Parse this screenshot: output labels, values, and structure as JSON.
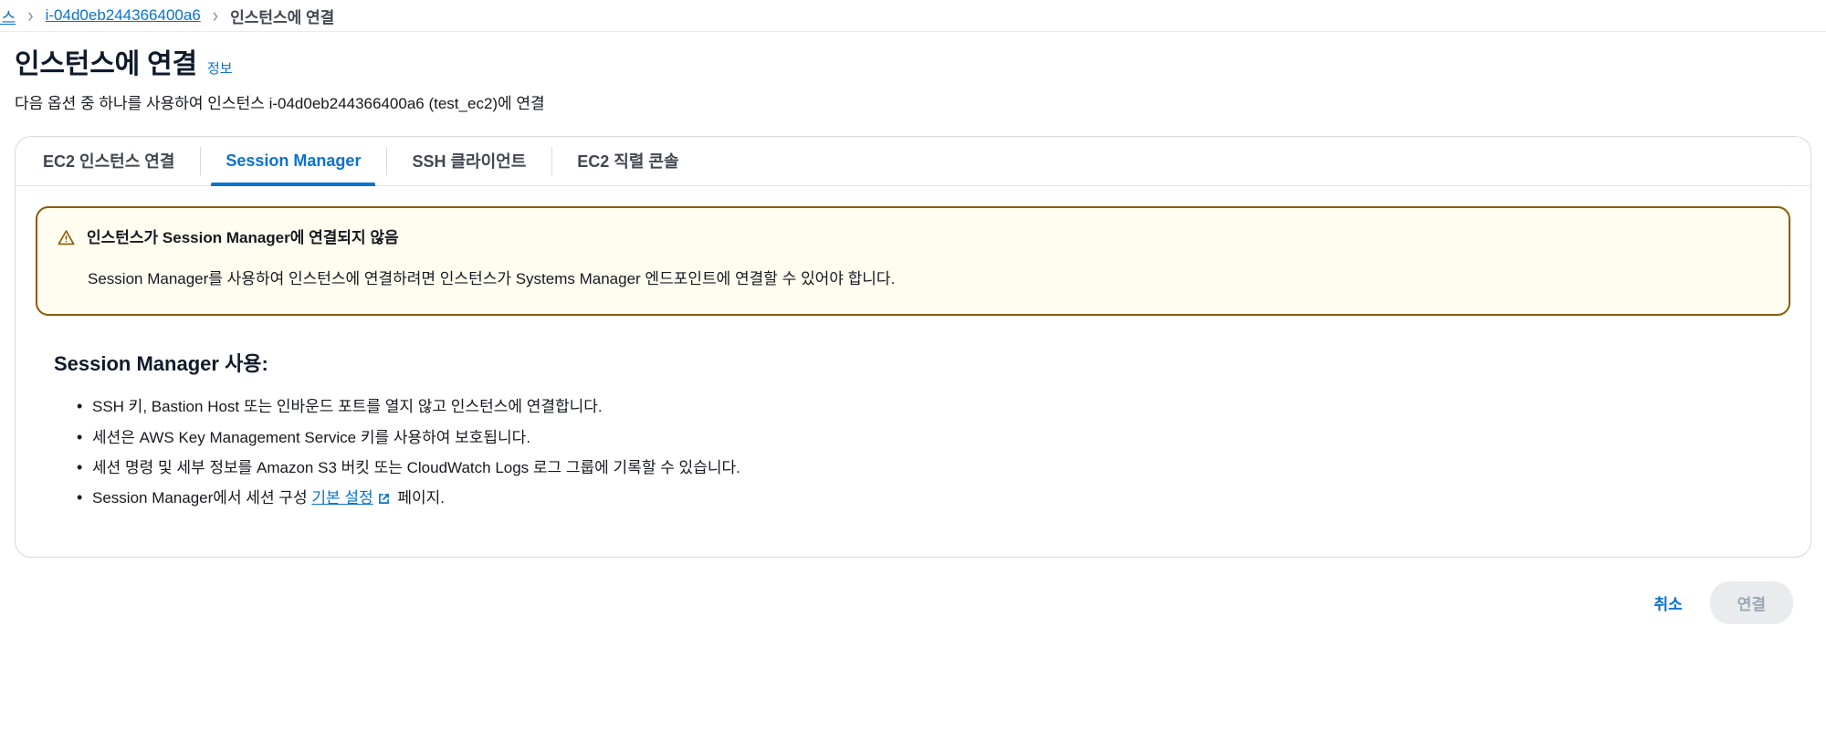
{
  "breadcrumb": {
    "items": [
      {
        "label": "턴스",
        "type": "link",
        "truncated": true
      },
      {
        "label": "i-04d0eb244366400a6",
        "type": "link"
      },
      {
        "label": "인스턴스에 연결",
        "type": "current"
      }
    ],
    "separator": "›"
  },
  "header": {
    "title": "인스턴스에 연결",
    "info_label": "정보",
    "description": "다음 옵션 중 하나를 사용하여 인스턴스 i-04d0eb244366400a6 (test_ec2)에 연결"
  },
  "tabs": [
    {
      "label": "EC2 인스턴스 연결",
      "active": false
    },
    {
      "label": "Session Manager",
      "active": true
    },
    {
      "label": "SSH 클라이언트",
      "active": false
    },
    {
      "label": "EC2 직렬 콘솔",
      "active": false
    }
  ],
  "alert": {
    "icon": "warning-triangle-icon",
    "title": "인스턴스가 Session Manager에 연결되지 않음",
    "body": "Session Manager를 사용하여 인스턴스에 연결하려면 인스턴스가 Systems Manager 엔드포인트에 연결할 수 있어야 합니다.",
    "border_color": "#8a5a0a",
    "background_color": "#fffdf0"
  },
  "usage": {
    "heading": "Session Manager 사용:",
    "items": [
      {
        "text": "SSH 키, Bastion Host 또는 인바운드 포트를 열지 않고 인스턴스에 연결합니다."
      },
      {
        "text": "세션은 AWS Key Management Service 키를 사용하여 보호됩니다."
      },
      {
        "text": "세션 명령 및 세부 정보를 Amazon S3 버킷 또는 CloudWatch Logs 로그 그룹에 기록할 수 있습니다."
      },
      {
        "prefix": "Session Manager에서 세션 구성 ",
        "link": "기본 설정",
        "suffix": " 페이지.",
        "has_external_icon": true
      }
    ]
  },
  "footer": {
    "cancel_label": "취소",
    "connect_label": "연결",
    "connect_disabled": true
  },
  "colors": {
    "link": "#0972d3",
    "accent": "#0972d3",
    "warning_border": "#8a5a0a",
    "warning_bg": "#fffdf0",
    "disabled_bg": "#e9ebed",
    "disabled_text": "#9ba7b6"
  }
}
